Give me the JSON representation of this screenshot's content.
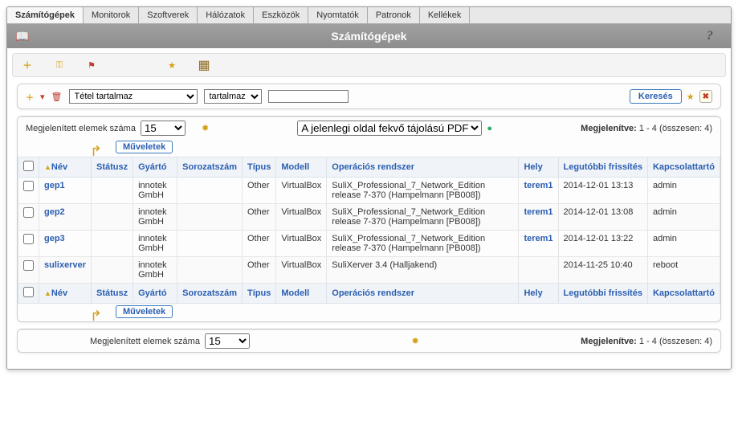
{
  "tabs": [
    "Számítógépek",
    "Monitorok",
    "Szoftverek",
    "Hálózatok",
    "Eszközök",
    "Nyomtatók",
    "Patronok",
    "Kellékek"
  ],
  "active_tab": 0,
  "title": "Számítógépek",
  "search": {
    "field_select": "Tétel tartalmaz",
    "op_select": "tartalmaz",
    "value": "",
    "submit_label": "Keresés"
  },
  "pager": {
    "count_label": "Megjelenített elemek száma",
    "count_value": "15",
    "export_select": "A jelenlegi oldal fekvő tájolású PDF-ben",
    "status_label": "Megjelenítve:",
    "status_range": "1 - 4 (összesen: 4)"
  },
  "actions_label": "Műveletek",
  "columns": [
    "",
    "Név",
    "Státusz",
    "Gyártó",
    "Sorozatszám",
    "Típus",
    "Modell",
    "Operációs rendszer",
    "Hely",
    "Legutóbbi frissítés",
    "Kapcsolattartó"
  ],
  "rows": [
    {
      "nev": "gep1",
      "statusz": "",
      "gyarto": "innotek GmbH",
      "sorozat": "",
      "tipus": "Other",
      "modell": "VirtualBox",
      "os": "SuliX_Professional_7_Network_Edition release 7-370 (Hampelmann [PB008])",
      "hely": "terem1",
      "frissites": "2014-12-01 13:13",
      "kapcs": "admin"
    },
    {
      "nev": "gep2",
      "statusz": "",
      "gyarto": "innotek GmbH",
      "sorozat": "",
      "tipus": "Other",
      "modell": "VirtualBox",
      "os": "SuliX_Professional_7_Network_Edition release 7-370 (Hampelmann [PB008])",
      "hely": "terem1",
      "frissites": "2014-12-01 13:08",
      "kapcs": "admin"
    },
    {
      "nev": "gep3",
      "statusz": "",
      "gyarto": "innotek GmbH",
      "sorozat": "",
      "tipus": "Other",
      "modell": "VirtualBox",
      "os": "SuliX_Professional_7_Network_Edition release 7-370 (Hampelmann [PB008])",
      "hely": "terem1",
      "frissites": "2014-12-01 13:22",
      "kapcs": "admin"
    },
    {
      "nev": "sulixerver",
      "statusz": "",
      "gyarto": "innotek GmbH",
      "sorozat": "",
      "tipus": "Other",
      "modell": "VirtualBox",
      "os": "SuliXerver 3.4 (Halljakend)",
      "hely": "",
      "frissites": "2014-11-25 10:40",
      "kapcs": "reboot"
    }
  ]
}
